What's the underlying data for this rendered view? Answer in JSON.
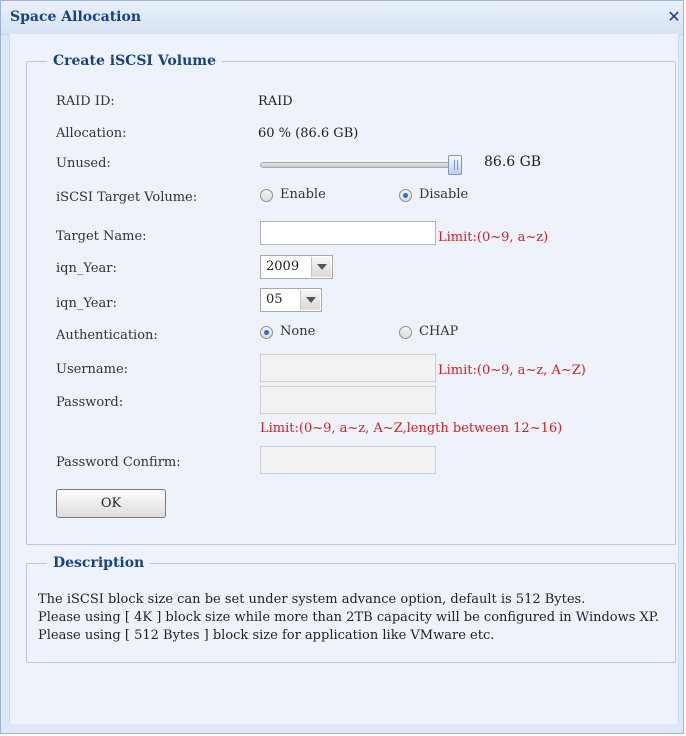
{
  "dialog": {
    "title": "Space Allocation",
    "close_glyph": "✕"
  },
  "create_section": {
    "legend": "Create iSCSI Volume",
    "raid_id_label": "RAID ID:",
    "raid_id_value": "RAID",
    "allocation_label": "Allocation:",
    "allocation_value": "60 % (86.6 GB)",
    "unused_label": "Unused:",
    "unused_value": "86.6 GB",
    "unused_slider_fraction": 1.0,
    "target_volume_label": "iSCSI Target Volume:",
    "target_volume_options": [
      "Enable",
      "Disable"
    ],
    "target_volume_selected": "Disable",
    "target_name_label": "Target Name:",
    "target_name_value": "",
    "target_name_limit": "Limit:(0~9, a~z)",
    "iqn_year_label": "iqn_Year:",
    "iqn_year_value": "2009",
    "iqn_month_label": "iqn_Year:",
    "iqn_month_value": "05",
    "auth_label": "Authentication:",
    "auth_options": [
      "None",
      "CHAP"
    ],
    "auth_selected": "None",
    "username_label": "Username:",
    "username_value": "",
    "username_limit": "Limit:(0~9, a~z, A~Z)",
    "password_label": "Password:",
    "password_value": "",
    "password_limit": "Limit:(0~9, a~z, A~Z,length between 12~16)",
    "password_confirm_label": "Password Confirm:",
    "password_confirm_value": "",
    "ok_label": "OK"
  },
  "description": {
    "legend": "Description",
    "lines": [
      "The iSCSI block size can be set under system advance option, default is 512 Bytes.",
      "Please using [ 4K ] block size while more than 2TB capacity will be configured in Windows XP.",
      "Please using [ 512 Bytes ] block size for application like VMware etc."
    ]
  },
  "colors": {
    "title": "#15428b",
    "limit_text": "#d81e1e",
    "panel_bg": "#eef3fb"
  }
}
